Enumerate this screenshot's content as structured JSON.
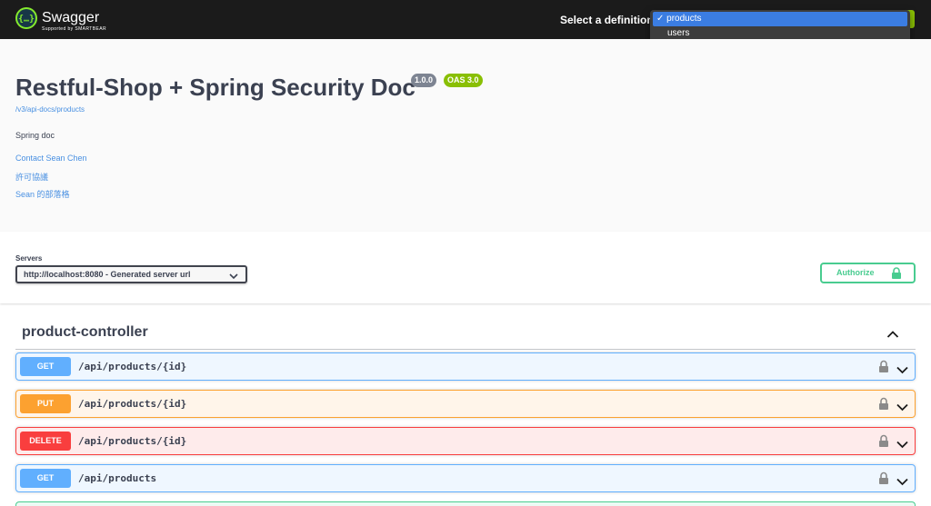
{
  "header": {
    "brand": "Swagger",
    "brand_sub": "Supported by SMARTBEAR",
    "select_label": "Select a definition",
    "definitions": [
      "products",
      "users"
    ],
    "selected_definition": "products",
    "selected_check": "✓ products"
  },
  "info": {
    "title": "Restful-Shop + Spring Security Doc",
    "version": "1.0.0",
    "oas": "OAS 3.0",
    "spec_url": "/v3/api-docs/products",
    "description": "Spring doc",
    "links": [
      "Contact Sean Chen",
      "許可協議",
      "Sean 的部落格"
    ]
  },
  "servers": {
    "label": "Servers",
    "selected": "http://localhost:8080 - Generated server url",
    "authorize_label": "Authorize"
  },
  "tag": {
    "name": "product-controller"
  },
  "operations": [
    {
      "method": "GET",
      "path": "/api/products/{id}"
    },
    {
      "method": "PUT",
      "path": "/api/products/{id}"
    },
    {
      "method": "DELETE",
      "path": "/api/products/{id}"
    },
    {
      "method": "GET",
      "path": "/api/products"
    }
  ],
  "colors": {
    "get": "#61affe",
    "put": "#fca130",
    "delete": "#f93e3e",
    "post": "#49cc90",
    "swagger_green": "#89bf04",
    "link": "#4990e2"
  },
  "icons": {
    "logo": "swagger-logo-icon",
    "lock": "lock-icon",
    "chevron": "chevron-down-icon",
    "collapse": "chevron-up-icon"
  }
}
